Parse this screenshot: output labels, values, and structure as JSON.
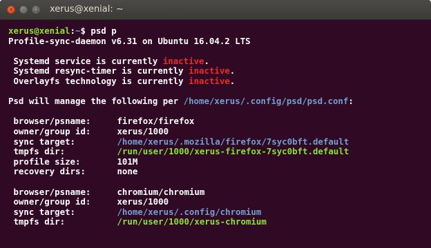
{
  "window": {
    "title": "xerus@xenial: ~",
    "buttons": {
      "close_icon": "close-icon",
      "minimize_icon": "minimize-icon",
      "maximize_icon": "maximize-icon"
    }
  },
  "colors": {
    "terminal_bg": "#300a24",
    "prompt_user": "#8ae234",
    "prompt_path": "#729fcf",
    "inactive": "#ef2929",
    "path": "#729fcf",
    "recovery_path": "#8ae234"
  },
  "prompt": {
    "user_host": "xerus@xenial",
    "sep": ":",
    "path": "~",
    "symbol": "$ ",
    "command": "psd p"
  },
  "header": "Profile-sync-daemon v6.31 on Ubuntu 16.04.2 LTS",
  "status": [
    {
      "text": "Systemd service is currently ",
      "state": "inactive",
      "end": "."
    },
    {
      "text": "Systemd resync-timer is currently ",
      "state": "inactive",
      "end": "."
    },
    {
      "text": "Overlayfs technology is currently ",
      "state": "inactive",
      "end": "."
    }
  ],
  "manage": {
    "text": "Psd will manage the following per ",
    "conf_path": "/home/xerus/.config/psd/psd.conf",
    "end": ":"
  },
  "browsers": [
    {
      "rows": [
        {
          "label": "browser/psname:",
          "value": "firefox/firefox"
        },
        {
          "label": "owner/group id:",
          "value": "xerus/1000"
        },
        {
          "label": "sync target:",
          "value": "/home/xerus/.mozilla/firefox/7syc0bft.default"
        },
        {
          "label": "tmpfs dir:",
          "value": "/run/user/1000/xerus-firefox-7syc0bft.default"
        },
        {
          "label": "profile size:",
          "value": "101M"
        },
        {
          "label": "recovery dirs:",
          "value": "none"
        }
      ]
    },
    {
      "rows": [
        {
          "label": "browser/psname:",
          "value": "chromium/chromium"
        },
        {
          "label": "owner/group id:",
          "value": "xerus/1000"
        },
        {
          "label": "sync target:",
          "value": "/home/xerus/.config/chromium"
        },
        {
          "label": "tmpfs dir:",
          "value": "/run/user/1000/xerus-chromium"
        }
      ]
    }
  ]
}
